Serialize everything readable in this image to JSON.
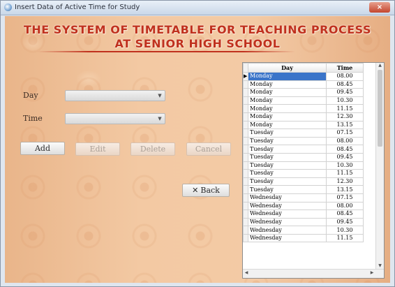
{
  "window": {
    "title": "Insert Data of Active Time for Study",
    "close_label": "×"
  },
  "heading": {
    "line1": "THE SYSTEM OF TIMETABLE FOR TEACHING PROCESS",
    "line2": "AT SENIOR HIGH SCHOOL"
  },
  "form": {
    "day_label": "Day",
    "time_label": "Time",
    "day_value": "",
    "time_value": ""
  },
  "buttons": {
    "add": "Add",
    "edit": "Edit",
    "delete": "Delete",
    "cancel": "Cancel",
    "back": "Back"
  },
  "grid": {
    "columns": [
      "Day",
      "Time"
    ],
    "selected_row": 0,
    "rows": [
      [
        "Monday",
        "08.00"
      ],
      [
        "Monday",
        "08.45"
      ],
      [
        "Monday",
        "09.45"
      ],
      [
        "Monday",
        "10.30"
      ],
      [
        "Monday",
        "11.15"
      ],
      [
        "Monday",
        "12.30"
      ],
      [
        "Monday",
        "13.15"
      ],
      [
        "Tuesday",
        "07.15"
      ],
      [
        "Tuesday",
        "08.00"
      ],
      [
        "Tuesday",
        "08.45"
      ],
      [
        "Tuesday",
        "09.45"
      ],
      [
        "Tuesday",
        "10.30"
      ],
      [
        "Tuesday",
        "11.15"
      ],
      [
        "Tuesday",
        "12.30"
      ],
      [
        "Tuesday",
        "13.15"
      ],
      [
        "Wednesday",
        "07.15"
      ],
      [
        "Wednesday",
        "08.00"
      ],
      [
        "Wednesday",
        "08.45"
      ],
      [
        "Wednesday",
        "09.45"
      ],
      [
        "Wednesday",
        "10.30"
      ],
      [
        "Wednesday",
        "11.15"
      ]
    ]
  }
}
